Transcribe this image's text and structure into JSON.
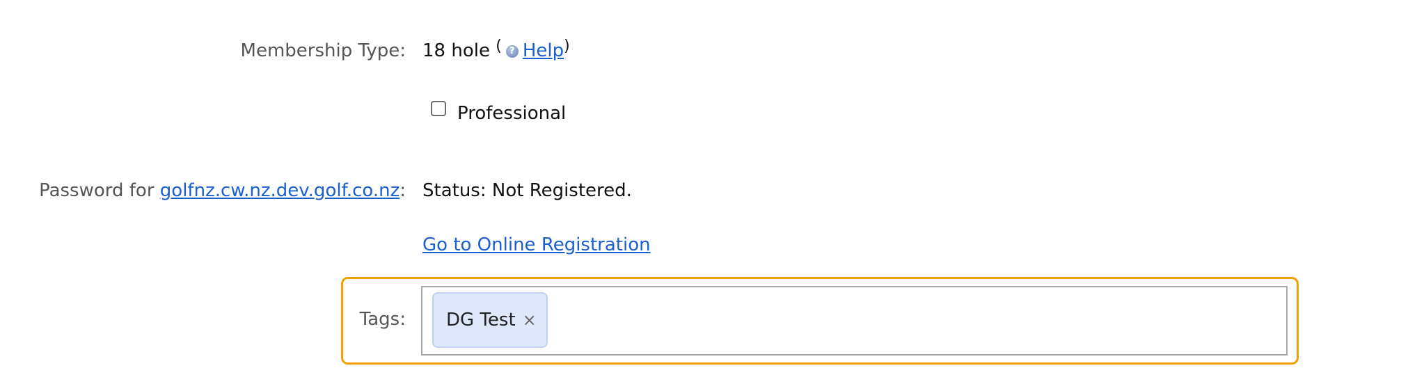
{
  "membership": {
    "label": "Membership Type:",
    "value": "18 hole",
    "paren_open": "(",
    "help_link": "Help",
    "paren_close": ")"
  },
  "professional": {
    "label": "Professional",
    "checked": false
  },
  "password": {
    "label_prefix": "Password for ",
    "domain_link": "golfnz.cw.nz.dev.golf.co.nz",
    "label_suffix": ":",
    "status": "Status: Not Registered.",
    "registration_link": "Go to Online Registration"
  },
  "tags": {
    "label": "Tags:",
    "items": [
      {
        "text": "DG Test",
        "remove": "×"
      }
    ]
  },
  "colors": {
    "highlight": "#f0a000",
    "link": "#1a5fd0",
    "chip_bg": "#dfe7fb"
  },
  "icons": {
    "help": "help-circle-icon",
    "remove": "close-icon"
  }
}
